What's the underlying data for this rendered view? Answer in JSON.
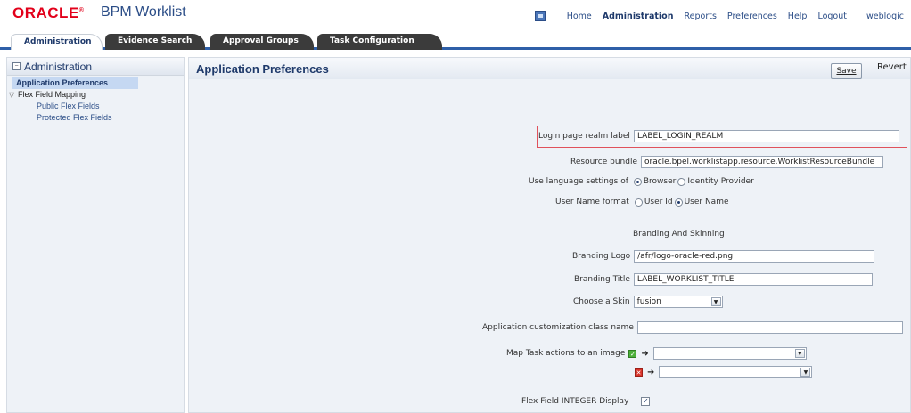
{
  "header": {
    "logo_text": "ORACLE",
    "logo_mark": "®",
    "app_title": "BPM Worklist",
    "nav_icon": "worklist-icon",
    "nav": {
      "home": "Home",
      "administration": "Administration",
      "reports": "Reports",
      "preferences": "Preferences",
      "help": "Help",
      "logout": "Logout",
      "user": "weblogic"
    }
  },
  "tabs": [
    {
      "label": "Administration",
      "active": true
    },
    {
      "label": "Evidence Search",
      "active": false
    },
    {
      "label": "Approval Groups",
      "active": false
    },
    {
      "label": "Task Configuration",
      "active": false
    }
  ],
  "left_panel": {
    "title": "Administration",
    "collapse_icon": "collapse-icon",
    "tree": {
      "app_prefs": "Application Preferences",
      "flex_mapping": "Flex Field Mapping",
      "public_flex": "Public Flex Fields",
      "protected_flex": "Protected Flex Fields"
    }
  },
  "main": {
    "title": "Application Preferences",
    "save_label": "Save",
    "revert_label": "Revert",
    "login_realm": {
      "label": "Login page realm label",
      "value": "LABEL_LOGIN_REALM"
    },
    "resource_bundle": {
      "label": "Resource bundle",
      "value": "oracle.bpel.worklistapp.resource.WorklistResourceBundle"
    },
    "language": {
      "label": "Use language settings of",
      "options": [
        "Browser",
        "Identity Provider"
      ],
      "selected": "Browser"
    },
    "username_format": {
      "label": "User Name format",
      "options": [
        "User Id",
        "User Name"
      ],
      "selected": "User Name"
    },
    "branding_section": "Branding And Skinning",
    "branding_logo": {
      "label": "Branding Logo",
      "value": "/afr/logo-oracle-red.png"
    },
    "branding_title": {
      "label": "Branding Title",
      "value": "LABEL_WORKLIST_TITLE"
    },
    "skin": {
      "label": "Choose a Skin",
      "value": "fusion"
    },
    "customization_class": {
      "label": "Application customization class name",
      "value": ""
    },
    "map_actions": {
      "label": "Map Task actions to an image",
      "approve_value": "",
      "reject_value": ""
    },
    "flex_integer": {
      "label": "Flex Field INTEGER Display",
      "checked": true
    }
  }
}
